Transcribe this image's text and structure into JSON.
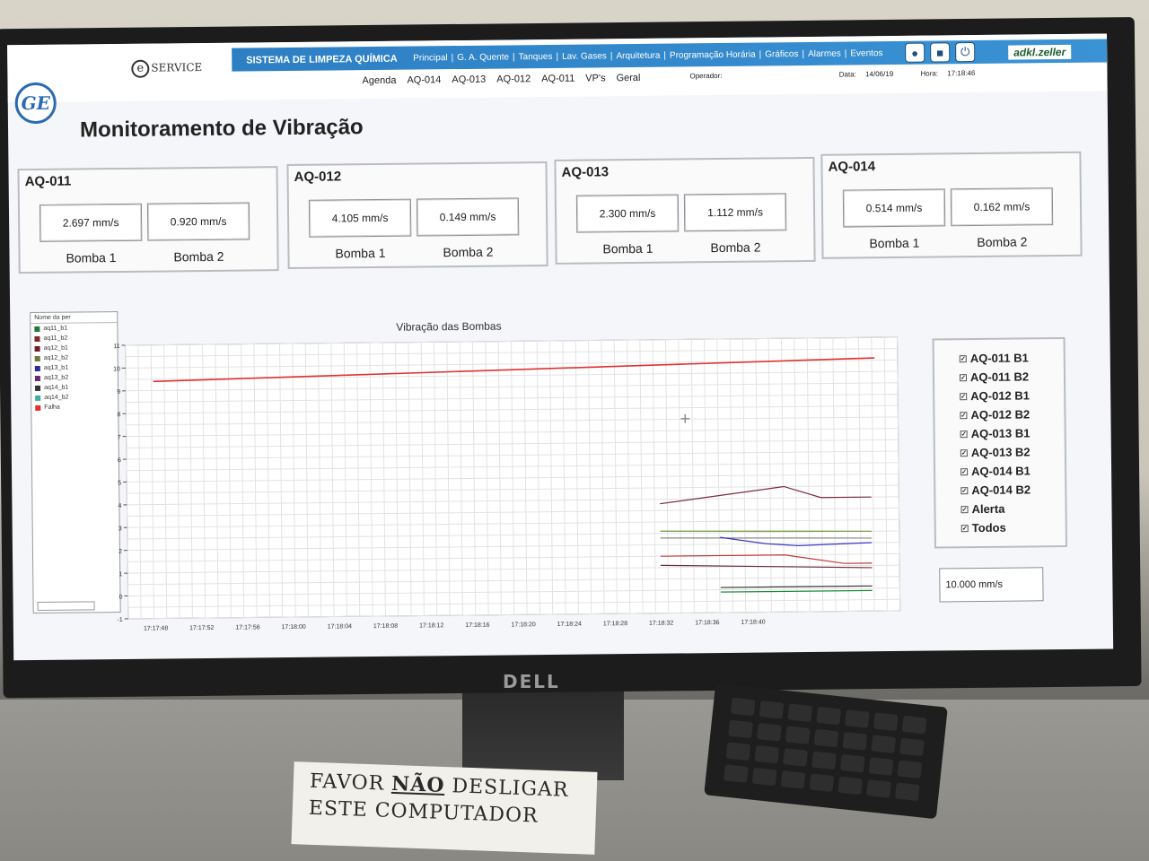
{
  "header": {
    "eservice": "SERVICE",
    "system_name": "SISTEMA DE LIMPEZA QUÍMICA",
    "nav_main": [
      "Principal",
      "G. A. Quente",
      "Tanques",
      "Lav. Gases",
      "Arquitetura",
      "Programação Horária",
      "Gráficos",
      "Alarmes",
      "Eventos"
    ],
    "nav_sub": [
      "Agenda",
      "AQ-014",
      "AQ-013",
      "AQ-012",
      "AQ-011",
      "VP's",
      "Geral"
    ],
    "operator_label": "Operador:",
    "date_label": "Data:",
    "date_value": "14/06/19",
    "time_label": "Hora:",
    "time_value": "17:18:46",
    "partner_logo": "adkl.zeller",
    "ge_logo": "GE",
    "icons": [
      "user-icon",
      "lock-icon",
      "power-icon"
    ]
  },
  "page_title": "Monitoramento de Vibração",
  "groups": [
    {
      "name": "AQ-011",
      "b1": "2.697 mm/s",
      "b2": "0.920 mm/s"
    },
    {
      "name": "AQ-012",
      "b1": "4.105 mm/s",
      "b2": "0.149 mm/s"
    },
    {
      "name": "AQ-013",
      "b1": "2.300 mm/s",
      "b2": "1.112 mm/s"
    },
    {
      "name": "AQ-014",
      "b1": "0.514 mm/s",
      "b2": "0.162 mm/s"
    }
  ],
  "pump_labels": {
    "b1": "Bomba 1",
    "b2": "Bomba 2"
  },
  "legend_panel": {
    "header": "Nome da per",
    "items": [
      {
        "label": "aq11_b1",
        "color": "#1f7a3a"
      },
      {
        "label": "aq11_b2",
        "color": "#7a2a2a"
      },
      {
        "label": "aq12_b1",
        "color": "#6b1f2a"
      },
      {
        "label": "aq12_b2",
        "color": "#6a7a3a"
      },
      {
        "label": "aq13_b1",
        "color": "#2a2a9a"
      },
      {
        "label": "aq13_b2",
        "color": "#6a2a6a"
      },
      {
        "label": "aq14_b1",
        "color": "#333333"
      },
      {
        "label": "aq14_b2",
        "color": "#3ab0a0"
      },
      {
        "label": "Falha",
        "color": "#e03030"
      }
    ]
  },
  "series_panel": {
    "items": [
      "AQ-011 B1",
      "AQ-011 B2",
      "AQ-012 B1",
      "AQ-012 B2",
      "AQ-013 B1",
      "AQ-013 B2",
      "AQ-014 B1",
      "AQ-014 B2",
      "Alerta",
      "Todos"
    ],
    "check_mark": "✓"
  },
  "limit_value": "10.000 mm/s",
  "monitor_brand": "DELL",
  "note": {
    "line1_pre": "FAVOR ",
    "line1_bold": "NÃO",
    "line1_post": " DESLIGAR",
    "line2": "ESTE COMPUTADOR"
  },
  "chart_data": {
    "type": "line",
    "title": "Vibração das Bombas",
    "ylim": [
      -1,
      11
    ],
    "yticks": [
      -1,
      0,
      1,
      2,
      3,
      4,
      5,
      6,
      7,
      8,
      9,
      10,
      11
    ],
    "xticks": [
      "17:17:48",
      "17:17:52",
      "17:17:56",
      "17:18:00",
      "17:18:04",
      "17:18:08",
      "17:18:12",
      "17:18:16",
      "17:18:20",
      "17:18:24",
      "17:18:28",
      "17:18:32",
      "17:18:36",
      "17:18:40"
    ],
    "grid": true,
    "series": [
      {
        "name": "Falha",
        "color": "#e03030",
        "x": [
          0,
          15.7
        ],
        "y": [
          9.4,
          10.1
        ]
      },
      {
        "name": "aq12_b1",
        "color": "#7a2a3a",
        "x": [
          11,
          13.7,
          14.5,
          15.6
        ],
        "y": [
          3.8,
          4.5,
          4.0,
          4.0
        ]
      },
      {
        "name": "aq11_b1",
        "color": "#6a9a3a",
        "x": [
          11,
          15.6
        ],
        "y": [
          2.6,
          2.5
        ]
      },
      {
        "name": "aq12_b2",
        "color": "#888888",
        "x": [
          11,
          15.6
        ],
        "y": [
          2.3,
          2.2
        ]
      },
      {
        "name": "aq13_b1",
        "color": "#3a3ac0",
        "x": [
          12.3,
          13.3,
          14.0,
          15.6
        ],
        "y": [
          2.3,
          2.0,
          1.9,
          2.0
        ]
      },
      {
        "name": "aq13_b2",
        "color": "#c03a3a",
        "x": [
          11,
          13.7,
          15.0,
          15.6
        ],
        "y": [
          1.5,
          1.5,
          1.1,
          1.1
        ]
      },
      {
        "name": "aq11_b2",
        "color": "#6a2a3a",
        "x": [
          11,
          15.6
        ],
        "y": [
          1.1,
          0.9
        ]
      },
      {
        "name": "aq14_b1",
        "color": "#333333",
        "x": [
          12.3,
          15.6
        ],
        "y": [
          0.1,
          0.1
        ]
      },
      {
        "name": "aq14_b2",
        "color": "#1f8a3a",
        "x": [
          12.3,
          15.6
        ],
        "y": [
          -0.1,
          -0.1
        ]
      }
    ]
  }
}
